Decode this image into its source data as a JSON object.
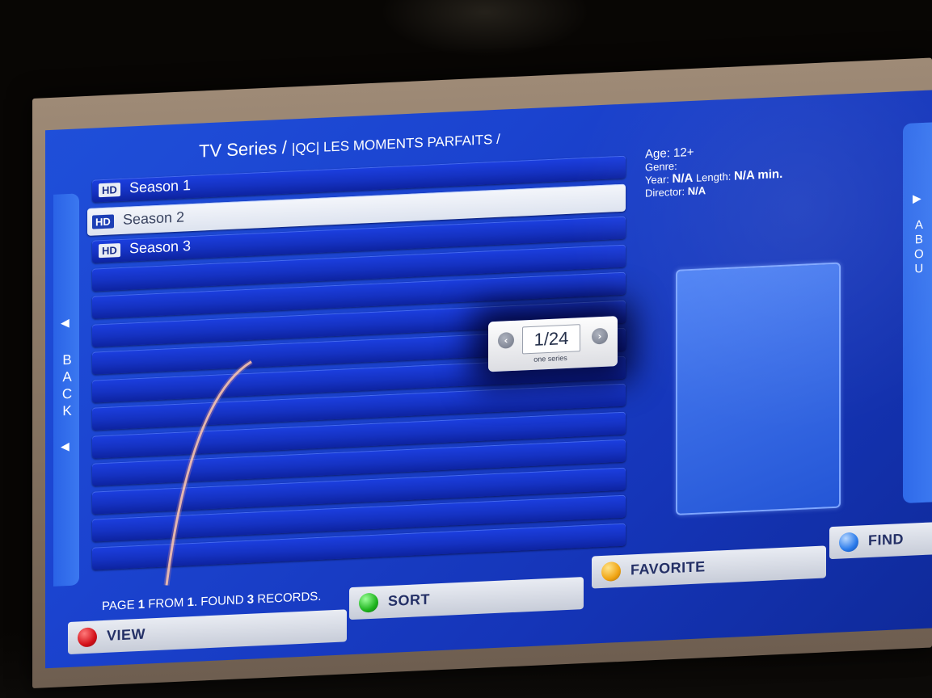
{
  "header": {
    "title": "TV Series / ",
    "subtitle": "|QC| LES MOMENTS PARFAITS /"
  },
  "seasons": [
    {
      "badge": "HD",
      "label": "Season 1"
    },
    {
      "badge": "HD",
      "label": "Season 2",
      "selected": true
    },
    {
      "badge": "HD",
      "label": "Season 3"
    }
  ],
  "info": {
    "age": "Age: 12+",
    "genre": "Genre:",
    "year_label": "Year: ",
    "year_value": "N/A",
    "length_label": " Length: ",
    "length_value": "N/A min.",
    "director_label": "Director: ",
    "director_value": "N/A"
  },
  "pager": {
    "value": "1/24",
    "caption": "one series",
    "prev_icon": "chevron-left-icon",
    "next_icon": "chevron-right-icon"
  },
  "side": {
    "back_letters": [
      "B",
      "A",
      "C",
      "K"
    ],
    "about_letters": [
      "A",
      "B",
      "O",
      "U"
    ]
  },
  "status": {
    "prefix": "PAGE ",
    "page": "1",
    "from": " FROM ",
    "total": "1",
    "found": ". FOUND ",
    "count": "3",
    "suffix": " RECORDS."
  },
  "buttons": {
    "view": "VIEW",
    "sort": "SORT",
    "favorite": "FAVORITE",
    "find": "FIND"
  },
  "colors": {
    "screen_blue": "#1b43cf",
    "red": "#d3101a",
    "green": "#1fb51f",
    "yellow": "#f0a413",
    "blue": "#2b7bea"
  }
}
